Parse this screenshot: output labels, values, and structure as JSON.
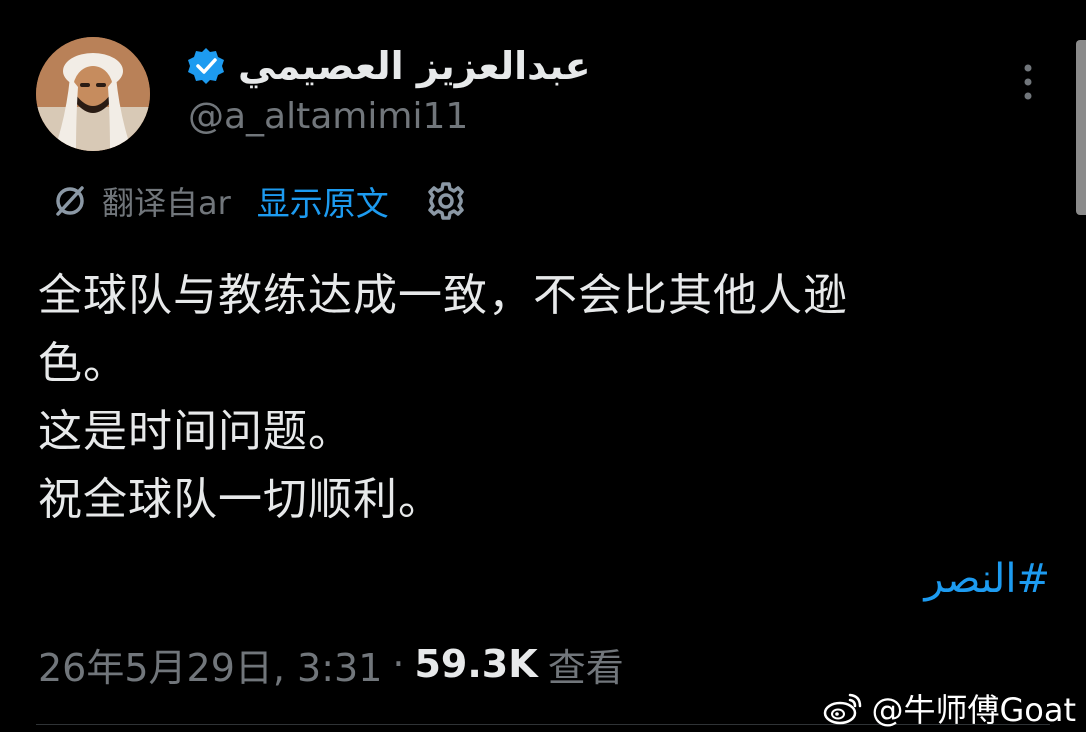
{
  "author": {
    "display_name": "عبدالعزيز العصيمي",
    "handle": "@a_altamimi11",
    "verified": true
  },
  "translation": {
    "translated_from": "翻译自ar",
    "show_original_label": "显示原文"
  },
  "tweet": {
    "lines": [
      "全球队与教练达成一致，不会比其他人逊",
      "色。",
      "这是时间问题。",
      "祝全球队一切顺利。"
    ],
    "hashtag": "#النصر"
  },
  "meta": {
    "date_time": "26年5月29日, 3:31",
    "separator": "·",
    "views_count": "59.3K",
    "views_label": "查看"
  },
  "watermark": {
    "text": "@牛师傅Goat"
  },
  "icons": {
    "verified": "verified-badge-icon",
    "more": "more-vertical-icon",
    "translate": "translate-icon",
    "settings": "gear-icon",
    "weibo": "weibo-logo-icon"
  },
  "colors": {
    "background": "#000000",
    "primary_text": "#e7e9ea",
    "secondary_text": "#71767b",
    "accent": "#1d9bf0"
  }
}
